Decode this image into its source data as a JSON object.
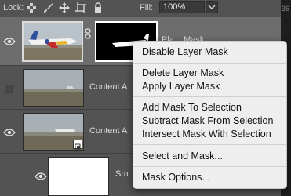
{
  "lock_bar": {
    "lock_label": "Lock:",
    "fill_label": "Fill:",
    "fill_value": "100%",
    "icons": [
      "lock-transparent-icon",
      "lock-paint-icon",
      "lock-move-icon",
      "lock-artboard-icon",
      "lock-all-icon"
    ]
  },
  "layers": [
    {
      "name": "Pla... Mask",
      "visible": true,
      "has_mask": true,
      "selected": true
    },
    {
      "name": "Content A",
      "visible": false,
      "has_mask": false
    },
    {
      "name": "Content A",
      "visible": true,
      "has_mask": false,
      "smart_object_badge": true
    },
    {
      "name": "Sm",
      "visible": true,
      "has_mask": false,
      "white_thumb": true
    }
  ],
  "context_menu": {
    "items": [
      "Disable Layer Mask",
      "Delete Layer Mask",
      "Apply Layer Mask",
      "Add Mask To Selection",
      "Subtract Mask From Selection",
      "Intersect Mask With Selection",
      "Select and Mask...",
      "Mask Options..."
    ]
  },
  "doc_strip": {
    "labels": [
      "36"
    ]
  },
  "colors": {
    "panel": "#535353",
    "menu_bg": "#eeeeee",
    "menu_text": "#111111",
    "selected_layer": "#6d6d6d"
  }
}
